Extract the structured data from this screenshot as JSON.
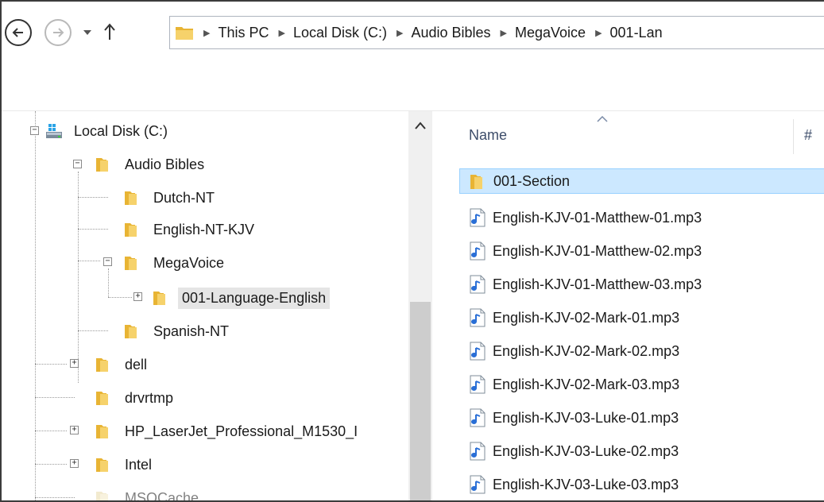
{
  "address": {
    "breadcrumbs": [
      "This PC",
      "Local Disk (C:)",
      "Audio Bibles",
      "MegaVoice",
      "001-Lan"
    ]
  },
  "tree": {
    "items": [
      {
        "label": "Local Disk (C:)"
      },
      {
        "label": "Audio Bibles"
      },
      {
        "label": "Dutch-NT"
      },
      {
        "label": "English-NT-KJV"
      },
      {
        "label": "MegaVoice"
      },
      {
        "label": "001-Language-English"
      },
      {
        "label": "Spanish-NT"
      },
      {
        "label": "dell"
      },
      {
        "label": "drvrtmp"
      },
      {
        "label": "HP_LaserJet_Professional_M1530_I"
      },
      {
        "label": "Intel"
      },
      {
        "label": "MSOCache"
      }
    ]
  },
  "files": {
    "columns": {
      "name": "Name",
      "number": "#"
    },
    "items": [
      {
        "label": "001-Section",
        "type": "folder"
      },
      {
        "label": "English-KJV-01-Matthew-01.mp3",
        "type": "audio"
      },
      {
        "label": "English-KJV-01-Matthew-02.mp3",
        "type": "audio"
      },
      {
        "label": "English-KJV-01-Matthew-03.mp3",
        "type": "audio"
      },
      {
        "label": "English-KJV-02-Mark-01.mp3",
        "type": "audio"
      },
      {
        "label": "English-KJV-02-Mark-02.mp3",
        "type": "audio"
      },
      {
        "label": "English-KJV-02-Mark-03.mp3",
        "type": "audio"
      },
      {
        "label": "English-KJV-03-Luke-01.mp3",
        "type": "audio"
      },
      {
        "label": "English-KJV-03-Luke-02.mp3",
        "type": "audio"
      },
      {
        "label": "English-KJV-03-Luke-03.mp3",
        "type": "audio"
      }
    ]
  },
  "colors": {
    "folder": "#e8b434",
    "selection": "#cce8ff",
    "tree_selection": "#e5e5e5",
    "audio_note": "#2a6fd6"
  },
  "icons": {
    "back": "back-arrow-icon",
    "forward": "forward-arrow-icon",
    "recent": "chevron-down-icon",
    "up": "up-arrow-icon",
    "folder": "folder-icon",
    "drive": "local-disk-icon",
    "audio": "audio-file-icon"
  }
}
